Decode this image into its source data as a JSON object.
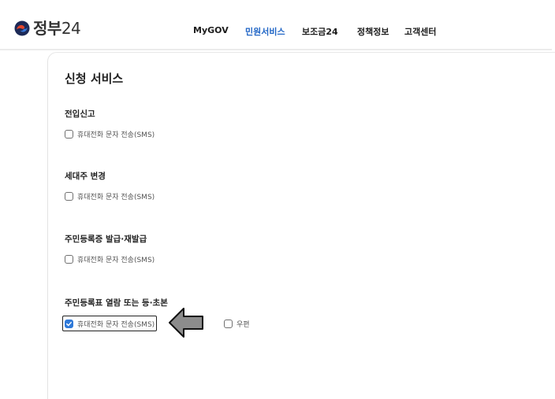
{
  "header": {
    "logo_text_main": "정부",
    "logo_text_num": "24",
    "nav": [
      {
        "label": "MyGOV",
        "active": false
      },
      {
        "label": "민원서비스",
        "active": true
      },
      {
        "label": "보조금24",
        "active": false
      },
      {
        "label": "정책정보",
        "active": false
      },
      {
        "label": "고객센터",
        "active": false
      }
    ]
  },
  "main": {
    "title": "신청 서비스",
    "sections": [
      {
        "title": "전입신고",
        "options": [
          {
            "label": "휴대전화 문자 전송(SMS)",
            "checked": false
          }
        ]
      },
      {
        "title": "세대주 변경",
        "options": [
          {
            "label": "휴대전화 문자 전송(SMS)",
            "checked": false
          }
        ]
      },
      {
        "title": "주민등록증 발급·재발급",
        "options": [
          {
            "label": "휴대전화 문자 전송(SMS)",
            "checked": false
          }
        ]
      },
      {
        "title": "주민등록표 열람 또는 등·초본",
        "options": [
          {
            "label": "휴대전화 문자 전송(SMS)",
            "checked": true
          },
          {
            "label": "우편",
            "checked": false
          }
        ]
      }
    ]
  },
  "colors": {
    "accent": "#2166c6",
    "checkbox_checked": "#2f79d8",
    "arrow_fill": "#8c8c8c"
  },
  "icons": {
    "logo": "gov-logo-icon",
    "checkmark": "checkmark-icon",
    "annotation": "left-arrow-icon"
  }
}
